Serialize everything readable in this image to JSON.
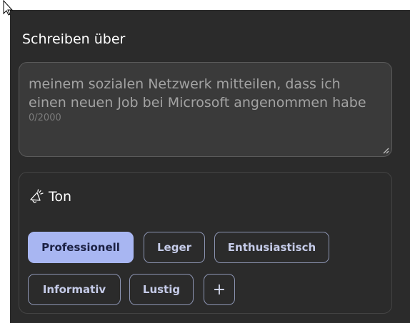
{
  "composer": {
    "title": "Schreiben über",
    "prompt_value": "meinem sozialen Netzwerk mitteilen, dass ich einen neuen Job bei Microsoft angenommen habe",
    "char_counter": "0/2000"
  },
  "tone": {
    "label": "Ton",
    "icon": "megaphone-icon",
    "options": [
      "Professionell",
      "Leger",
      "Enthusiastisch",
      "Informativ",
      "Lustig"
    ],
    "selected": "Professionell",
    "add_label": "+"
  },
  "colors": {
    "panel_bg": "#2b2b2b",
    "accent": "#a8b6f2",
    "chip_border": "#8c94b2"
  }
}
